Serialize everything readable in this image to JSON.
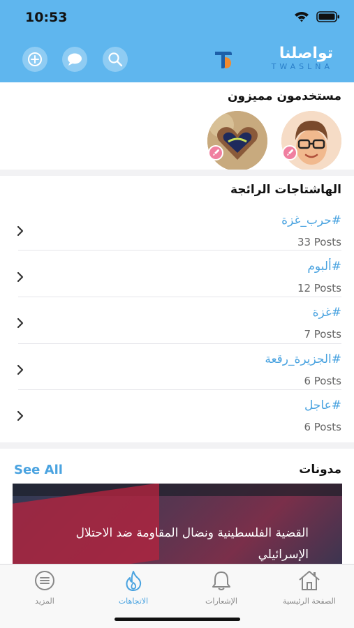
{
  "status_bar": {
    "time": "10:53"
  },
  "header": {
    "brand_arabic": "تواصلنا",
    "brand_english": "TWASLNA",
    "icons": [
      "add-icon",
      "chat-icon",
      "search-icon"
    ]
  },
  "featured_users": {
    "title": "مستخدمون مميزون",
    "users": [
      {
        "avatar": "memoji-glasses-avatar",
        "badge": "rocket-icon"
      },
      {
        "avatar": "heart-hands-avatar",
        "badge": "rocket-icon"
      }
    ]
  },
  "hashtags": {
    "title": "الهاشتاجات الرائجة",
    "items": [
      {
        "tag": "#حرب_غزة",
        "count": "33 Posts"
      },
      {
        "tag": "#ألبوم",
        "count": "12 Posts"
      },
      {
        "tag": "#غزة",
        "count": "7 Posts"
      },
      {
        "tag": "#الجزيرة_رقعة",
        "count": "6 Posts"
      },
      {
        "tag": "#عاجل",
        "count": "6 Posts"
      }
    ]
  },
  "blogs": {
    "title": "مدونات",
    "see_all": "See All",
    "card_title": "القضية الفلسطينية ونضال المقاومة ضد الاحتلال الإسرائيلي"
  },
  "tabbar": {
    "tabs": [
      {
        "label": "الصفحة الرئيسية",
        "icon": "home-icon",
        "active": false
      },
      {
        "label": "الإشعارات",
        "icon": "bell-icon",
        "active": false
      },
      {
        "label": "الاتجاهات",
        "icon": "flame-icon",
        "active": true
      },
      {
        "label": "المزيد",
        "icon": "menu-icon",
        "active": false
      }
    ]
  },
  "colors": {
    "header": "#5fb6ee",
    "accent": "#4aa3e0",
    "badge": "#f07fa0"
  }
}
